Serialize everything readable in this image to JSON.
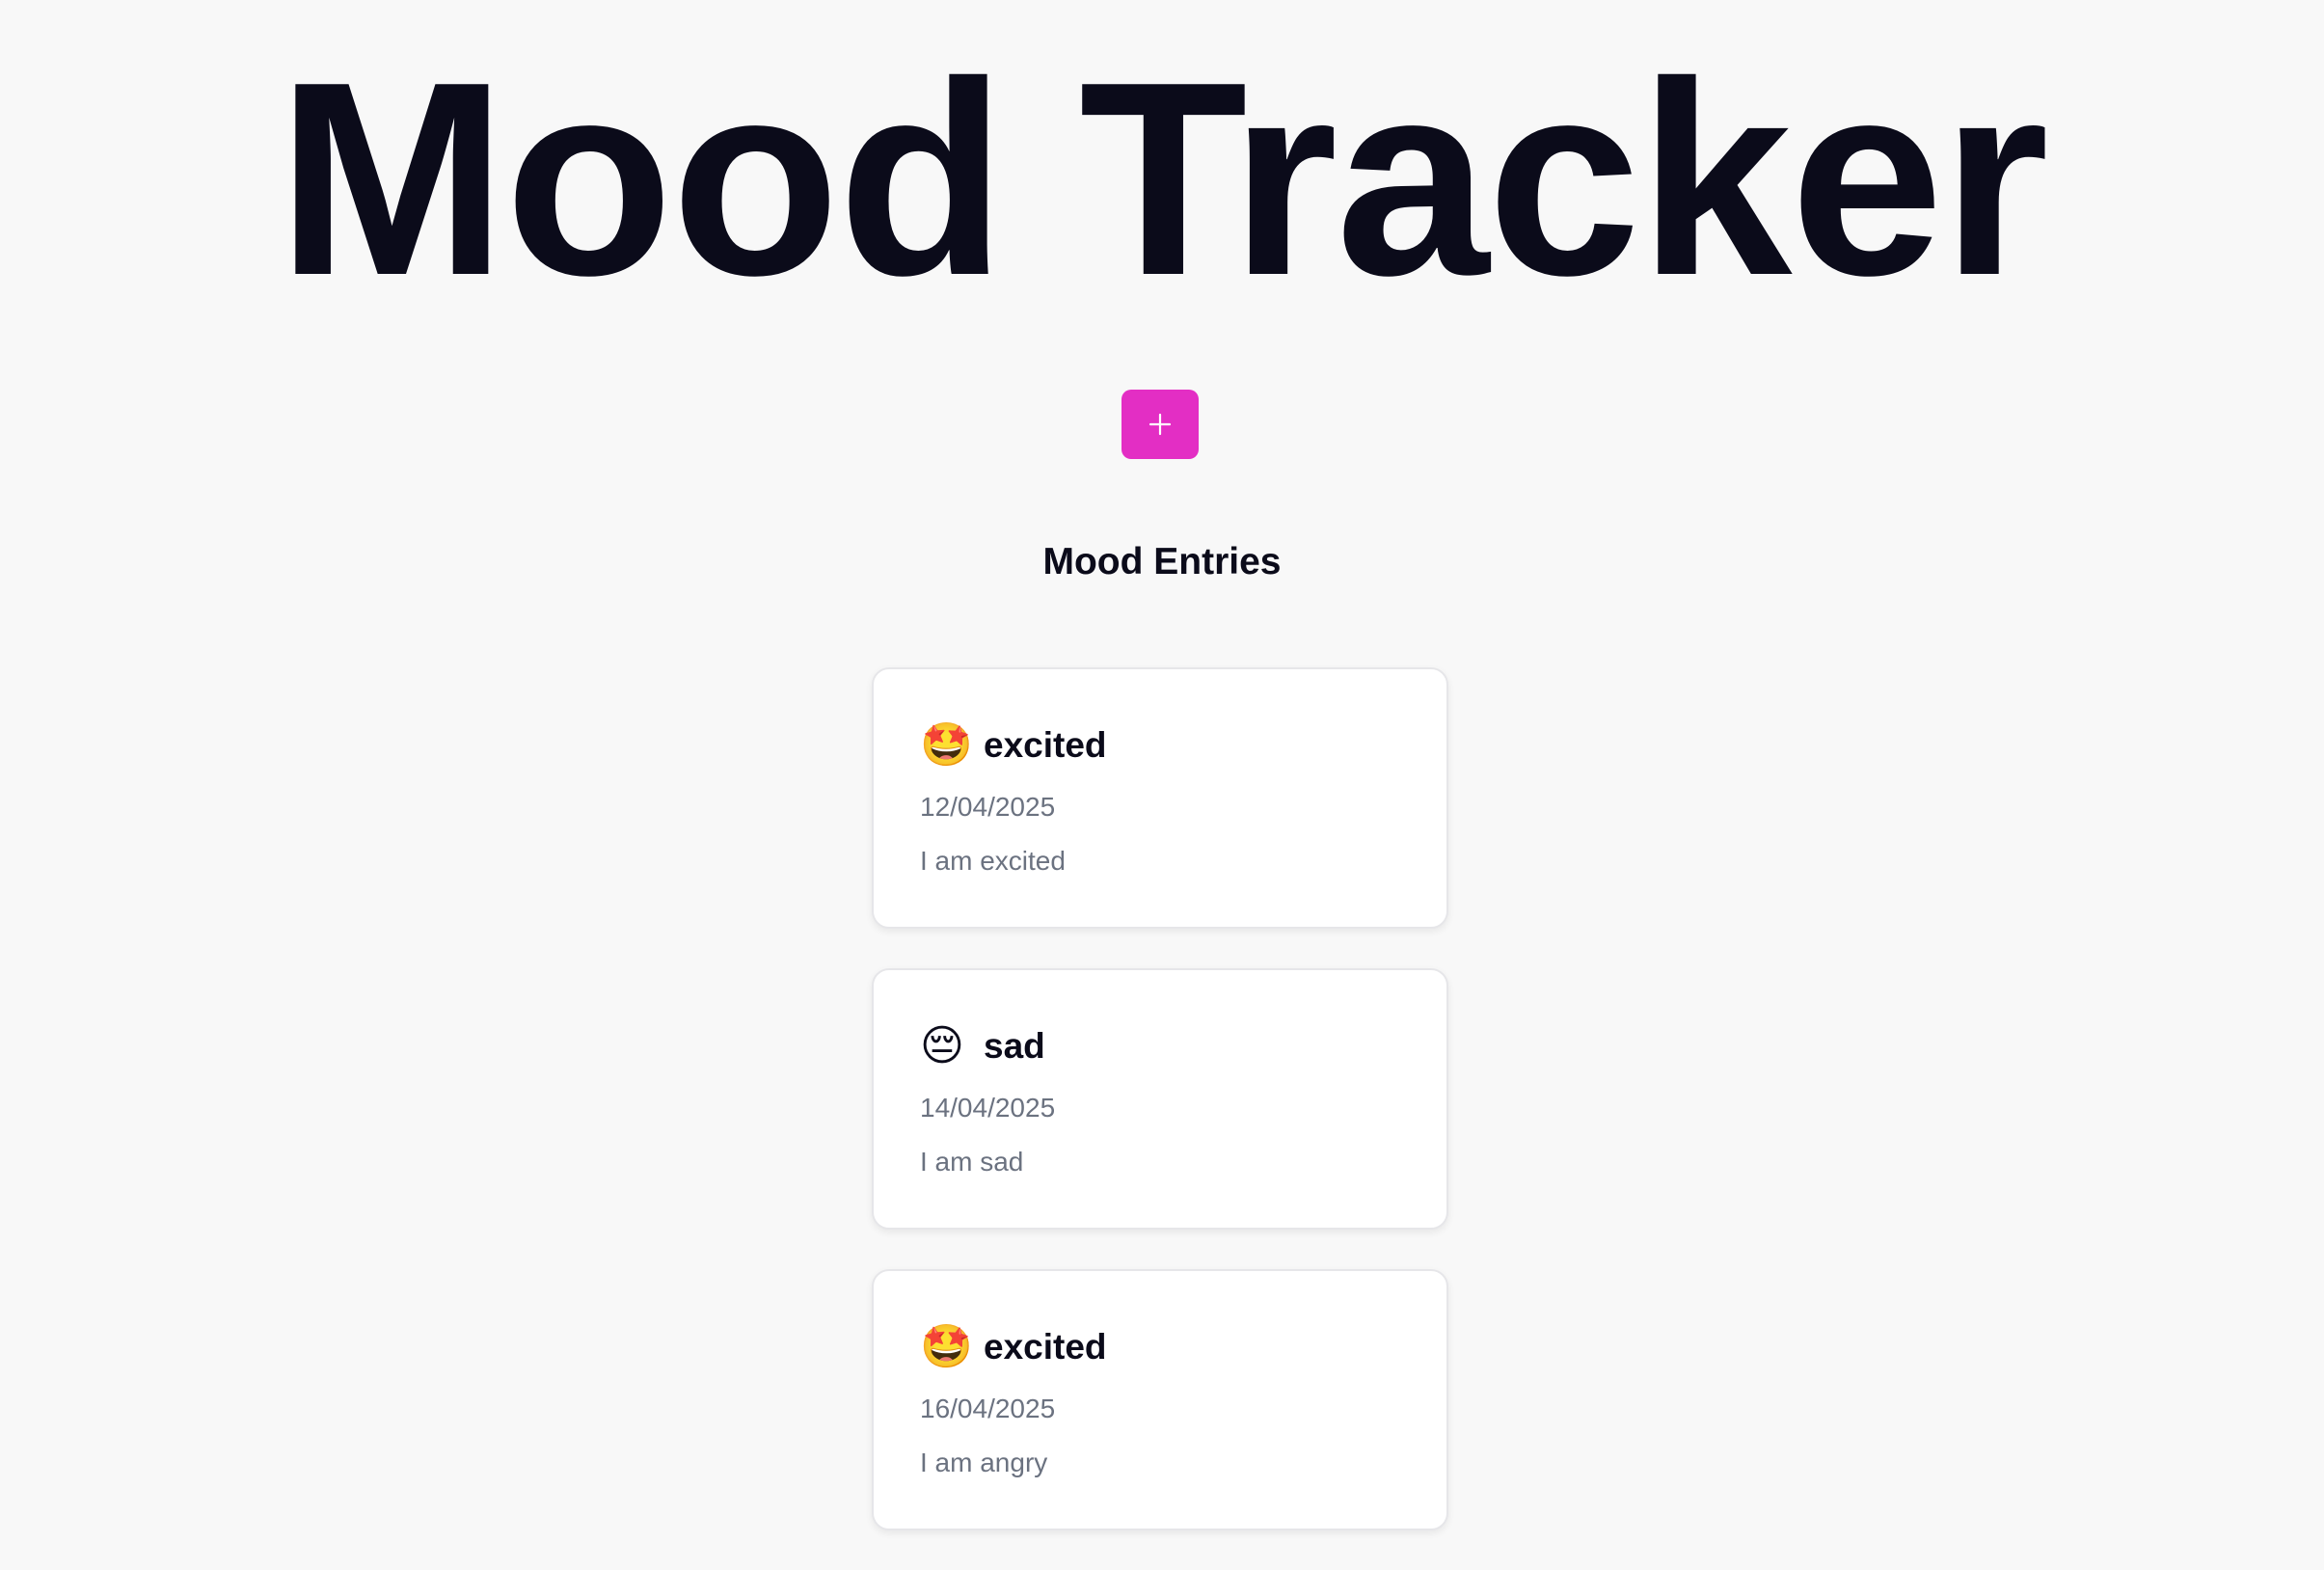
{
  "page": {
    "title": "Mood Tracker",
    "add_button_icon": "plus-icon",
    "accent_color": "#e32ec4",
    "background_color": "#f8f8f8"
  },
  "entries_section": {
    "title": "Mood Entries"
  },
  "entries": [
    {
      "emoji": "🤩",
      "emoji_icon": "star-struck-face-icon",
      "mood": "excited",
      "date": "12/04/2025",
      "note": "I am excited"
    },
    {
      "emoji": "😔",
      "emoji_icon": "pensive-face-icon",
      "mood": "sad",
      "date": "14/04/2025",
      "note": "I am sad"
    },
    {
      "emoji": "🤩",
      "emoji_icon": "star-struck-face-icon",
      "mood": "excited",
      "date": "16/04/2025",
      "note": "I am angry"
    }
  ]
}
